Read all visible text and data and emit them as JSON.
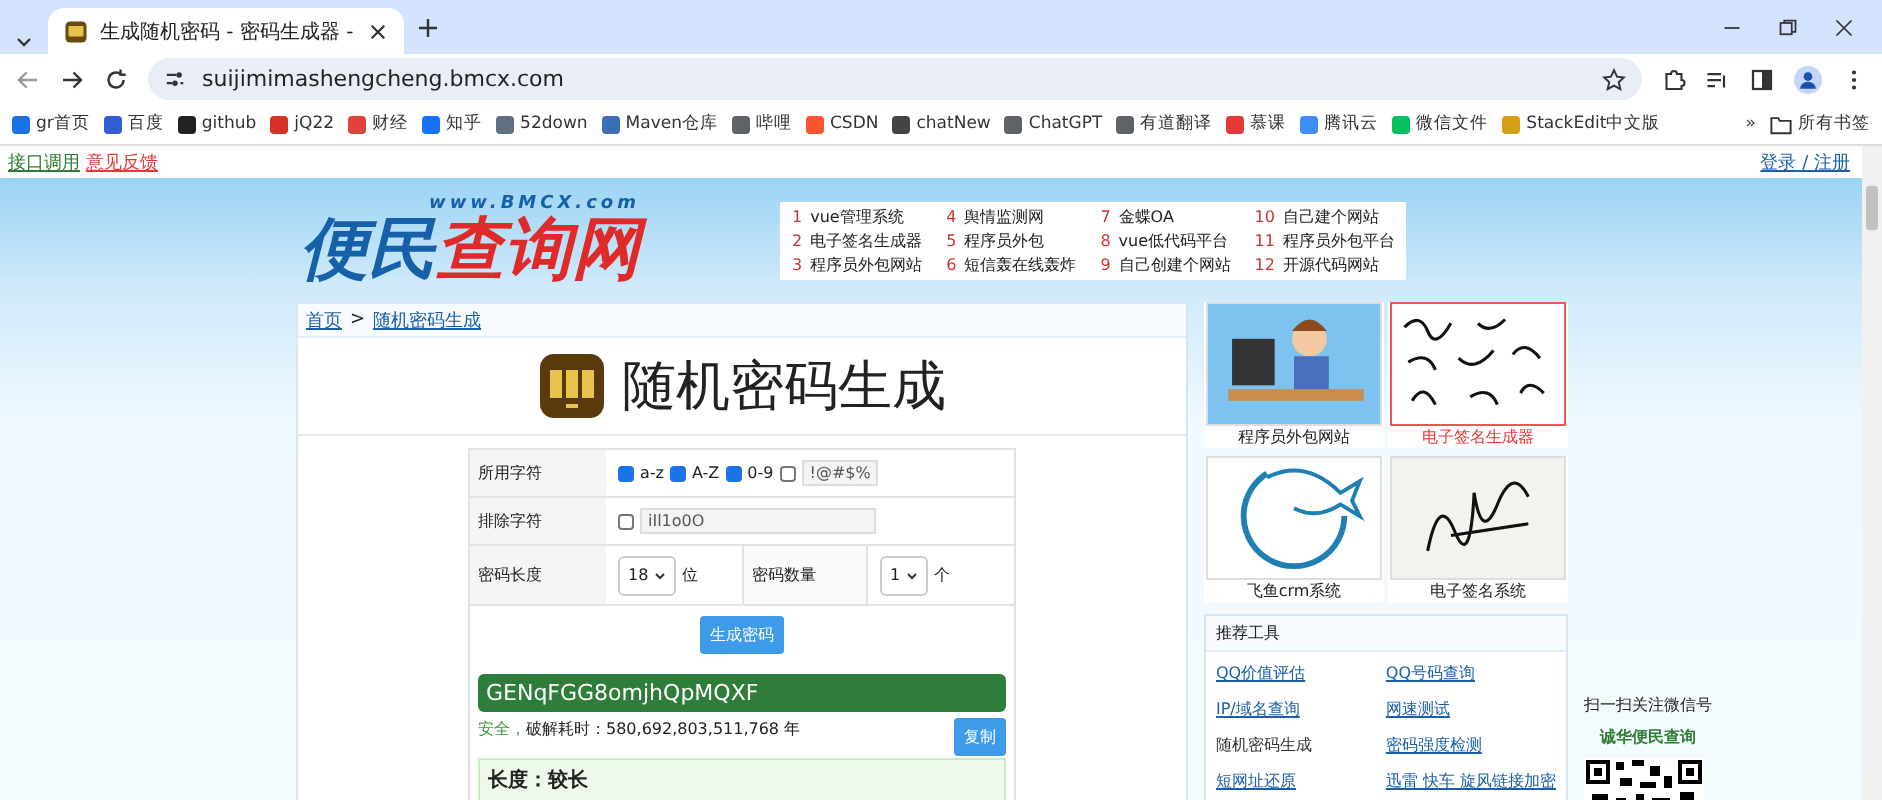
{
  "browser": {
    "tab_title": "生成随机密码 - 密码生成器 -",
    "url": "suijimimashengcheng.bmcx.com",
    "bookmarks": [
      {
        "label": "gr首页",
        "color": "#1a73e8"
      },
      {
        "label": "百度",
        "color": "#2f5fd0"
      },
      {
        "label": "github",
        "color": "#222222"
      },
      {
        "label": "jQ22",
        "color": "#d93025"
      },
      {
        "label": "财经",
        "color": "#e0413a"
      },
      {
        "label": "知乎",
        "color": "#1772f6"
      },
      {
        "label": "52down",
        "color": "#607080"
      },
      {
        "label": "Maven仓库",
        "color": "#3b6fb6"
      },
      {
        "label": "哔哩",
        "color": "#5f6368"
      },
      {
        "label": "CSDN",
        "color": "#fc5531"
      },
      {
        "label": "chatNew",
        "color": "#444444"
      },
      {
        "label": "ChatGPT",
        "color": "#5f6368"
      },
      {
        "label": "有道翻译",
        "color": "#5f6368"
      },
      {
        "label": "慕课",
        "color": "#e53935"
      },
      {
        "label": "腾讯云",
        "color": "#3e8ef7"
      },
      {
        "label": "微信文件",
        "color": "#07c160"
      },
      {
        "label": "StackEdit中文版",
        "color": "#d4a017"
      }
    ],
    "overflow": "»",
    "all_bookmarks": "所有书签"
  },
  "site": {
    "top_links": [
      {
        "label": "接口调用",
        "color": "#2e7d32"
      },
      {
        "label": "意见反馈",
        "color": "#e53935"
      }
    ],
    "login": "登录 / 注册",
    "logo": {
      "domain": "www.BMCX.com",
      "words": [
        {
          "text": "便民",
          "color": "#1560a8"
        },
        {
          "text": "查询网",
          "color": "#e02a2a"
        }
      ]
    },
    "hot_links": [
      {
        "num": "1",
        "label": "vue管理系统"
      },
      {
        "num": "4",
        "label": "舆情监测网"
      },
      {
        "num": "7",
        "label": "金蝶OA"
      },
      {
        "num": "10",
        "label": "自己建个网站"
      },
      {
        "num": "2",
        "label": "电子签名生成器"
      },
      {
        "num": "5",
        "label": "程序员外包"
      },
      {
        "num": "8",
        "label": "vue低代码平台"
      },
      {
        "num": "11",
        "label": "程序员外包平台"
      },
      {
        "num": "3",
        "label": "程序员外包网站"
      },
      {
        "num": "6",
        "label": "短信轰在线轰炸"
      },
      {
        "num": "9",
        "label": "自己创建个网站"
      },
      {
        "num": "12",
        "label": "开源代码网站"
      }
    ]
  },
  "breadcrumb": {
    "items": [
      "首页",
      "随机密码生成"
    ],
    "separator": ">"
  },
  "page_title": "随机密码生成",
  "form": {
    "charset_label": "所用字符",
    "charsets": [
      {
        "label": "a-z",
        "checked": true
      },
      {
        "label": "A-Z",
        "checked": true
      },
      {
        "label": "0-9",
        "checked": true
      },
      {
        "kind": "symbols",
        "value": "!@#$%",
        "checked": false
      }
    ],
    "exclude_label": "排除字符",
    "exclude_checked": false,
    "exclude_value": "iIl1o0O",
    "length_label": "密码长度",
    "length": "18",
    "length_unit": "位",
    "count_label": "密码数量",
    "count": "1",
    "count_unit": "个",
    "generate": "生成密码"
  },
  "result": {
    "password": "GENqFGG8omjhQpMQXF",
    "safety": "安全，",
    "crack_time": "破解耗时：580,692,803,511,768 年",
    "copy": "复制",
    "strength": "长度：较长"
  },
  "side_tiles": [
    {
      "kind": "programmer",
      "caption": "程序员外包网站",
      "selected": false
    },
    {
      "kind": "signatures",
      "caption": "电子签名生成器",
      "selected": true
    },
    {
      "kind": "fish",
      "caption": "飞鱼crm系统",
      "selected": false
    },
    {
      "kind": "signature",
      "caption": "电子签名系统",
      "selected": false
    }
  ],
  "tools": {
    "title": "推荐工具",
    "items": [
      {
        "label": "QQ价值评估",
        "selected": false
      },
      {
        "label": "QQ号码查询",
        "selected": false
      },
      {
        "label": "IP/域名查询",
        "selected": false
      },
      {
        "label": "网速测试",
        "selected": false
      },
      {
        "label": "随机密码生成",
        "selected": true
      },
      {
        "label": "密码强度检测",
        "selected": false
      },
      {
        "label": "短网址还原",
        "selected": false
      },
      {
        "label": "迅雷 快车 旋风链接加密",
        "selected": false
      }
    ]
  },
  "wechat": {
    "caption": "扫一扫关注微信号",
    "name": "诚华便民查询"
  }
}
